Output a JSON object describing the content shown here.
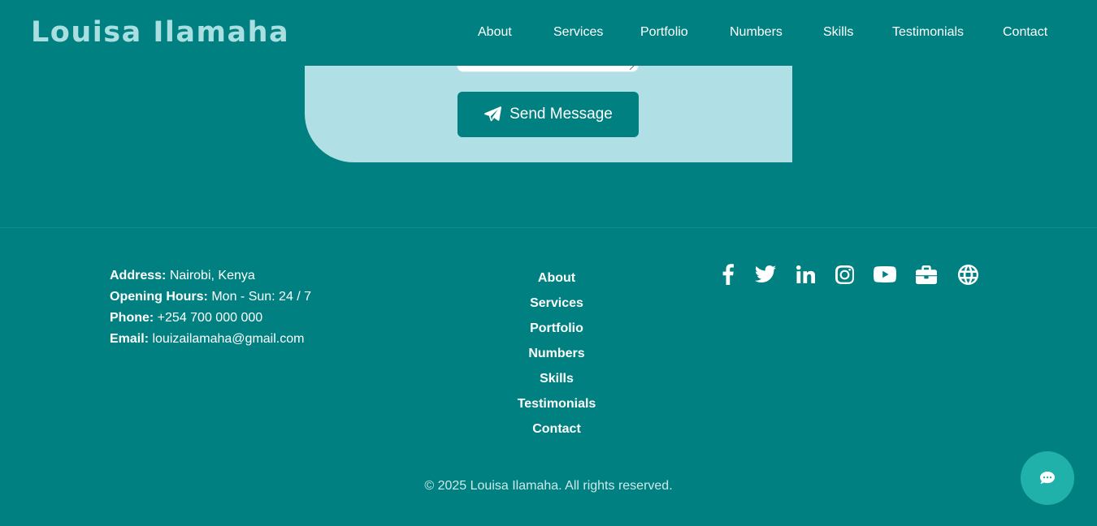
{
  "header": {
    "logo": "Louisa Ilamaha",
    "nav": [
      "About",
      "Services",
      "Portfolio",
      "Numbers",
      "Skills",
      "Testimonials",
      "Contact"
    ]
  },
  "contact_form": {
    "send_label": "Send Message"
  },
  "footer": {
    "contact": [
      {
        "label": "Address:",
        "value": "Nairobi, Kenya"
      },
      {
        "label": "Opening Hours:",
        "value": "Mon - Sun: 24 / 7"
      },
      {
        "label": "Phone:",
        "value": "+254 700 000 000"
      },
      {
        "label": "Email:",
        "value": "louizailamaha@gmail.com"
      }
    ],
    "links": [
      "About",
      "Services",
      "Portfolio",
      "Numbers",
      "Skills",
      "Testimonials",
      "Contact"
    ],
    "socials": [
      "facebook-icon",
      "twitter-icon",
      "linkedin-icon",
      "instagram-icon",
      "youtube-icon",
      "briefcase-icon",
      "globe-icon"
    ],
    "copyright": "© 2025 Louisa Ilamaha. All rights reserved."
  },
  "colors": {
    "primary": "#008080",
    "card": "#b0e0e6",
    "logo": "#aadfe2",
    "chat": "#20b2aa"
  }
}
